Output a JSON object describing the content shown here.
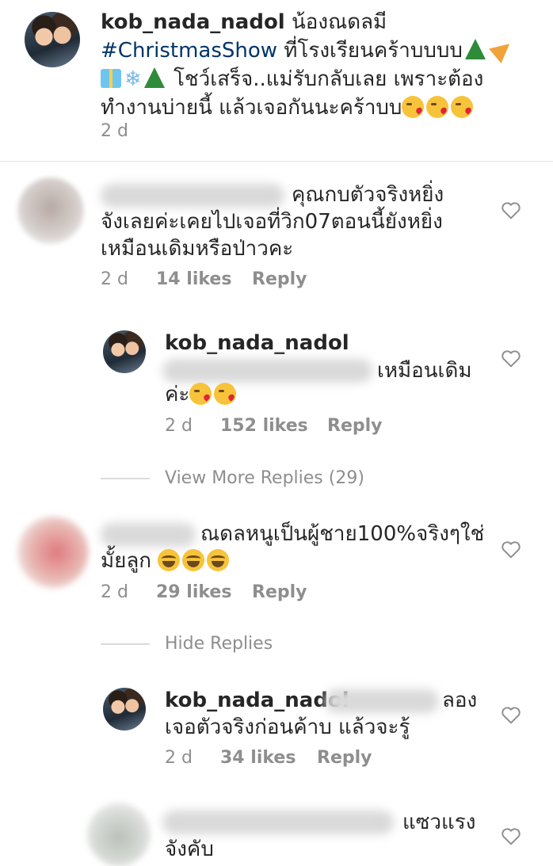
{
  "caption": {
    "username": "kob_nada_nadol",
    "text_1": " น้องณดลมี",
    "hashtag": "#ChristmasShow",
    "text_2": " ที่โรงเรียนคร้าบบบบ",
    "text_3": " โชว์เสร็จ..แม่รับกลับเลย เพราะต้อง",
    "text_4": "ทำงานบ่ายนี้ แล้วเจอกันนะคร้าบบ",
    "time": "2 d"
  },
  "comments": [
    {
      "text_line1": "คุณกบตัวจริงหยิ่ง",
      "text_line2": "จังเลยค่ะเคยไปเจอที่วิก07ตอนนี้ยังหยิ่ง",
      "text_line3": "เหมือนเดิมหรือป่าวคะ",
      "time": "2 d",
      "likes": "14 likes",
      "reply": "Reply"
    },
    {
      "username": "kob_nada_nadol",
      "text_line1": "เหมือนเดิม",
      "text_line2": "ค่ะ",
      "time": "2 d",
      "likes": "152 likes",
      "reply": "Reply"
    },
    {
      "text_line1": "ณดลหนูเป็นผู้ชาย100%จริงๆใช่",
      "text_line2": "มั้ยลูก",
      "time": "2 d",
      "likes": "29 likes",
      "reply": "Reply"
    },
    {
      "username": "kob_nada_nadol",
      "text_line1": "ลอง",
      "text_line2": "เจอตัวจริงก่อนค้าบ แล้วจะรู้",
      "time": "2 d",
      "likes": "34 likes",
      "reply": "Reply"
    },
    {
      "text_line1": "แซวแรง",
      "text_line2": "จังคับ"
    }
  ],
  "view_more_replies": "View More Replies (29)",
  "hide_replies": "Hide Replies",
  "colors": {
    "text": "#262626",
    "muted": "#8e8e8e",
    "hashtag": "#003569",
    "divider": "#dbdbdb"
  },
  "icons": [
    "heart-outline-icon",
    "christmas-tree-emoji",
    "party-popper-emoji",
    "gift-emoji",
    "snowflake-emoji",
    "kissing-face-emoji",
    "laughing-face-emoji"
  ]
}
